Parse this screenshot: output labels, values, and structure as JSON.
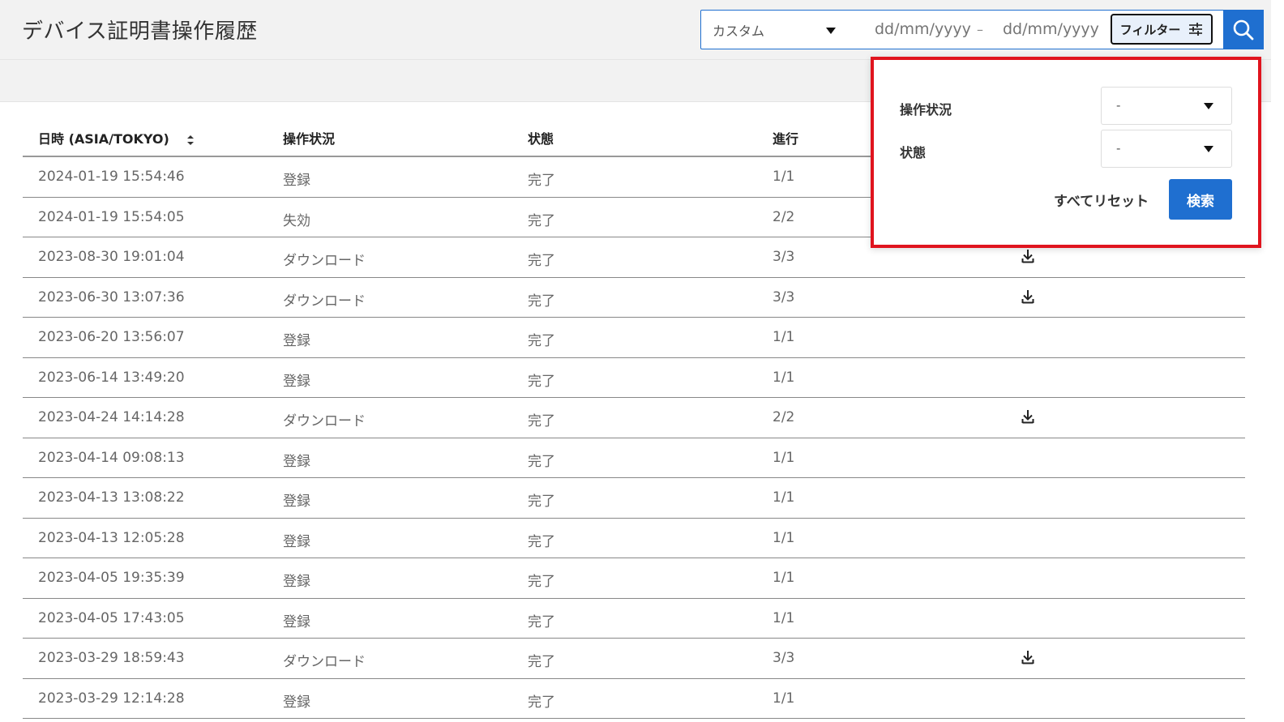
{
  "header": {
    "title": "デバイス証明書操作履歴",
    "period_select": "カスタム",
    "date_from_placeholder": "dd/mm/yyyy",
    "date_separator": "–",
    "date_to_placeholder": "dd/mm/yyyy",
    "filter_label": "フィルター",
    "accent_color": "#1f6fd0"
  },
  "table": {
    "columns": [
      "日時 (ASIA/TOKYO)",
      "操作状況",
      "状態",
      "進行"
    ],
    "rows": [
      {
        "datetime": "2024-01-19 15:54:46",
        "operation": "登録",
        "status": "完了",
        "progress": "1/1",
        "download": false
      },
      {
        "datetime": "2024-01-19 15:54:05",
        "operation": "失効",
        "status": "完了",
        "progress": "2/2",
        "download": false
      },
      {
        "datetime": "2023-08-30 19:01:04",
        "operation": "ダウンロード",
        "status": "完了",
        "progress": "3/3",
        "download": true
      },
      {
        "datetime": "2023-06-30 13:07:36",
        "operation": "ダウンロード",
        "status": "完了",
        "progress": "3/3",
        "download": true
      },
      {
        "datetime": "2023-06-20 13:56:07",
        "operation": "登録",
        "status": "完了",
        "progress": "1/1",
        "download": false
      },
      {
        "datetime": "2023-06-14 13:49:20",
        "operation": "登録",
        "status": "完了",
        "progress": "1/1",
        "download": false
      },
      {
        "datetime": "2023-04-24 14:14:28",
        "operation": "ダウンロード",
        "status": "完了",
        "progress": "2/2",
        "download": true
      },
      {
        "datetime": "2023-04-14 09:08:13",
        "operation": "登録",
        "status": "完了",
        "progress": "1/1",
        "download": false
      },
      {
        "datetime": "2023-04-13 13:08:22",
        "operation": "登録",
        "status": "完了",
        "progress": "1/1",
        "download": false
      },
      {
        "datetime": "2023-04-13 12:05:28",
        "operation": "登録",
        "status": "完了",
        "progress": "1/1",
        "download": false
      },
      {
        "datetime": "2023-04-05 19:35:39",
        "operation": "登録",
        "status": "完了",
        "progress": "1/1",
        "download": false
      },
      {
        "datetime": "2023-04-05 17:43:05",
        "operation": "登録",
        "status": "完了",
        "progress": "1/1",
        "download": false
      },
      {
        "datetime": "2023-03-29 18:59:43",
        "operation": "ダウンロード",
        "status": "完了",
        "progress": "3/3",
        "download": true
      },
      {
        "datetime": "2023-03-29 12:14:28",
        "operation": "登録",
        "status": "完了",
        "progress": "1/1",
        "download": false
      }
    ]
  },
  "filter_panel": {
    "operation_label": "操作状況",
    "operation_value": "-",
    "status_label": "状態",
    "status_value": "-",
    "reset_label": "すべてリセット",
    "apply_label": "検索",
    "highlight_color": "#e0141e"
  }
}
